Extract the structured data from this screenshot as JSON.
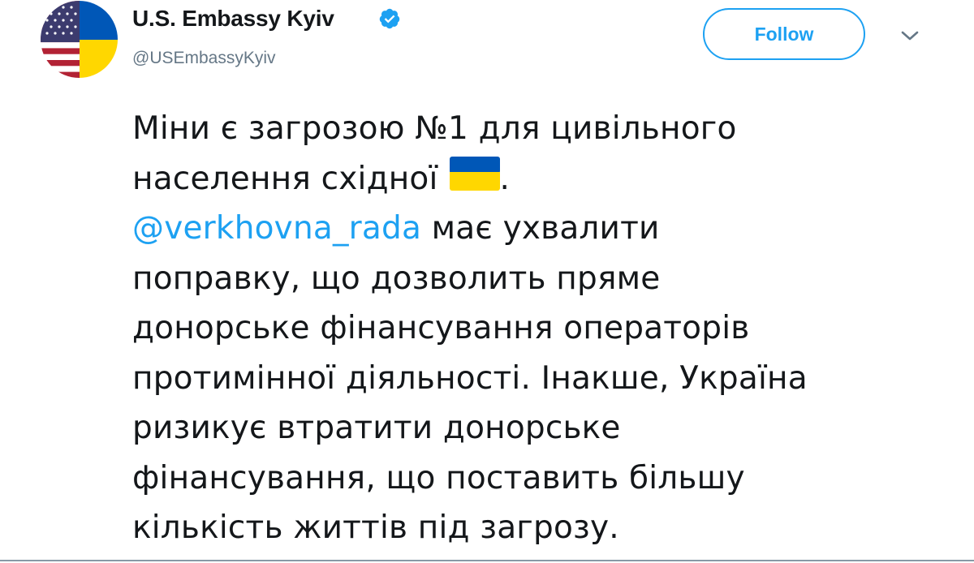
{
  "tweet": {
    "author": {
      "display_name": "U.S. Embassy Kyiv",
      "handle": "@USEmbassyKyiv",
      "verified": true,
      "avatar_icon": "us-ukraine-flag-avatar"
    },
    "follow_label": "Follow",
    "menu_icon": "chevron-down-icon",
    "text_lines": {
      "l1": "Міни є загрозою №1 для цивільного",
      "l2_before": "населення східної",
      "l2_emoji": "ukraine-flag-emoji",
      "l2_after": ".",
      "l3_mention": "@verkhovna_rada",
      "l3_rest": " має ухвалити",
      "l4": "поправку, що дозволить пряме",
      "l5": "донорське фінансування операторів",
      "l6": "протимінної діяльності. Інакше, Україна",
      "l7": "ризикує втратити донорське",
      "l8": "фінансування, що поставить більшу",
      "l9": "кількість життів під загрозу."
    }
  },
  "colors": {
    "accent": "#1da1f2",
    "text": "#14171a",
    "secondary_text": "#657786",
    "flag_blue": "#0057b7",
    "flag_yellow": "#ffd700"
  }
}
